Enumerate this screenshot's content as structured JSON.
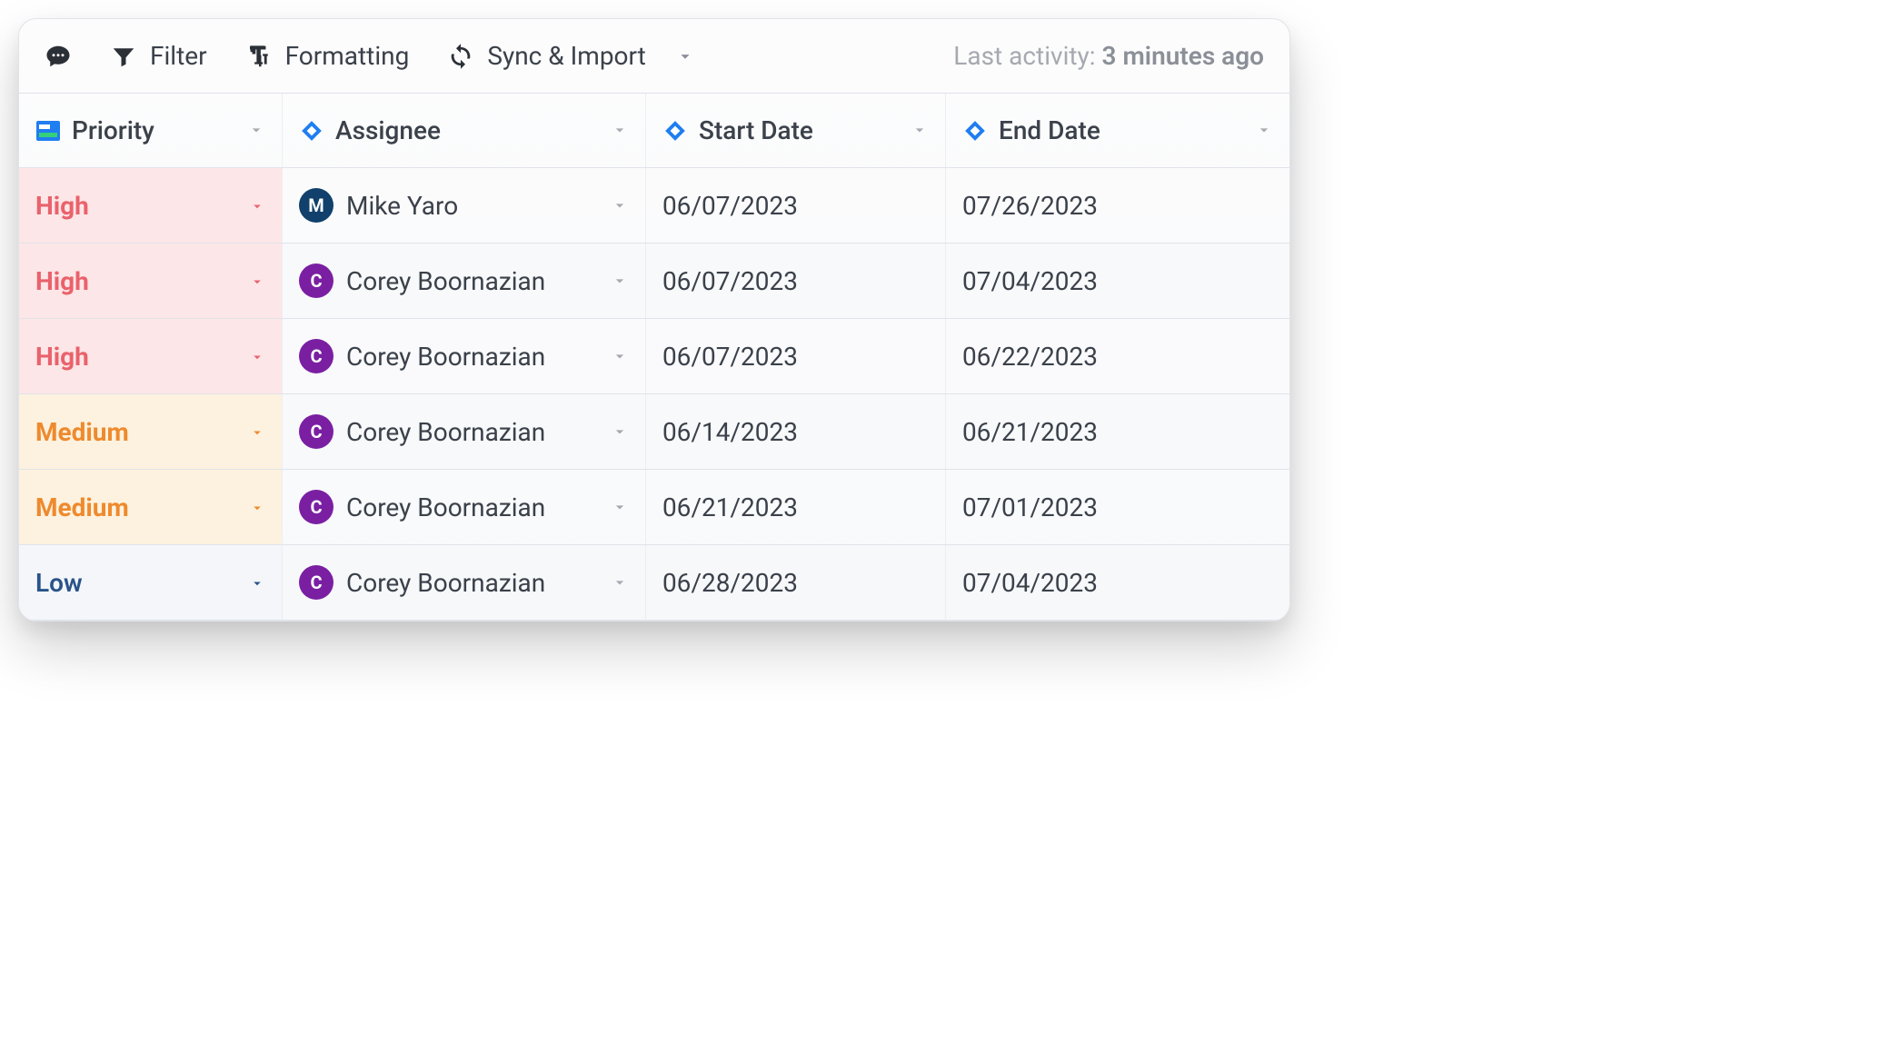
{
  "toolbar": {
    "filter_label": "Filter",
    "formatting_label": "Formatting",
    "sync_label": "Sync & Import",
    "activity_prefix": "Last activity: ",
    "activity_value": "3 minutes ago"
  },
  "columns": {
    "priority": "Priority",
    "assignee": "Assignee",
    "start_date": "Start Date",
    "end_date": "End Date"
  },
  "rows": [
    {
      "priority": "High",
      "assignee": "Mike Yaro",
      "avatar_letter": "M",
      "avatar_color": "#10406b",
      "start": "06/07/2023",
      "end": "07/26/2023"
    },
    {
      "priority": "High",
      "assignee": "Corey Boornazian",
      "avatar_letter": "C",
      "avatar_color": "#7a1fa2",
      "start": "06/07/2023",
      "end": "07/04/2023"
    },
    {
      "priority": "High",
      "assignee": "Corey Boornazian",
      "avatar_letter": "C",
      "avatar_color": "#7a1fa2",
      "start": "06/07/2023",
      "end": "06/22/2023"
    },
    {
      "priority": "Medium",
      "assignee": "Corey Boornazian",
      "avatar_letter": "C",
      "avatar_color": "#7a1fa2",
      "start": "06/14/2023",
      "end": "06/21/2023"
    },
    {
      "priority": "Medium",
      "assignee": "Corey Boornazian",
      "avatar_letter": "C",
      "avatar_color": "#7a1fa2",
      "start": "06/21/2023",
      "end": "07/01/2023"
    },
    {
      "priority": "Low",
      "assignee": "Corey Boornazian",
      "avatar_letter": "C",
      "avatar_color": "#7a1fa2",
      "start": "06/28/2023",
      "end": "07/04/2023"
    }
  ]
}
